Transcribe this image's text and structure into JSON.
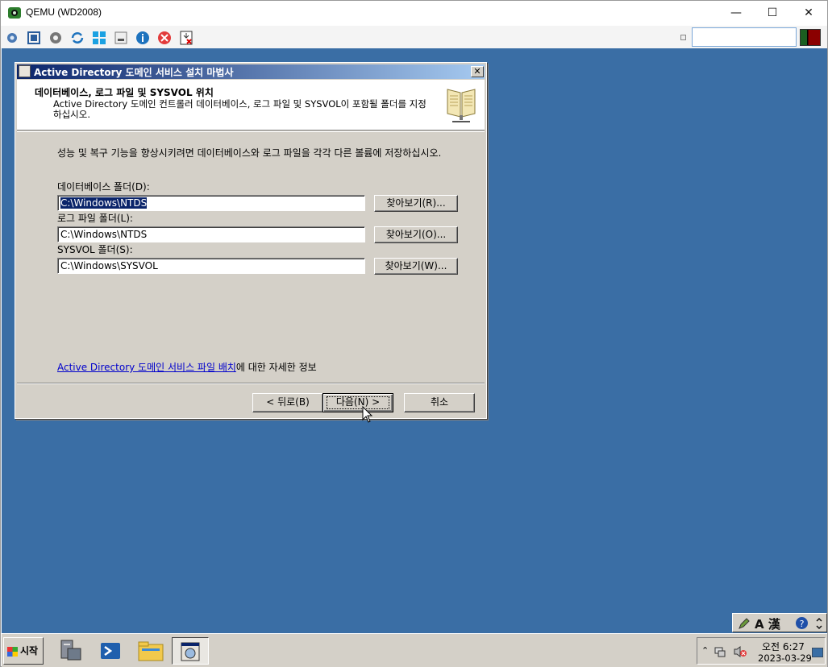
{
  "host": {
    "title": "QEMU (WD2008)",
    "minimize": "—",
    "maximize": "☐",
    "close": "✕"
  },
  "toolbar": {
    "icons": [
      "cluster-icon",
      "fullscreen-icon",
      "settings-icon",
      "refresh-icon",
      "windows-icon",
      "usb-icon",
      "info-icon",
      "stop-icon",
      "eject-icon"
    ],
    "search_value": ""
  },
  "wizard": {
    "title": "Active Directory 도메인 서비스 설치 마법사",
    "heading": "데이터베이스, 로그 파일 및 SYSVOL 위치",
    "subtext": "Active Directory 도메인 컨트롤러 데이터베이스, 로그 파일 및 SYSVOL이 포함될 폴더를 지정하십시오.",
    "intro": "성능 및 복구 기능을 향상시키려면 데이터베이스와 로그 파일을 각각 다른 볼륨에 저장하십시오.",
    "fields": [
      {
        "label": "데이터베이스 폴더(D):",
        "value": "C:\\Windows\\NTDS",
        "browse": "찾아보기(R)..."
      },
      {
        "label": "로그 파일 폴더(L):",
        "value": "C:\\Windows\\NTDS",
        "browse": "찾아보기(O)..."
      },
      {
        "label": "SYSVOL 폴더(S):",
        "value": "C:\\Windows\\SYSVOL",
        "browse": "찾아보기(W)..."
      }
    ],
    "link_text": "Active Directory 도메인 서비스 파일 배치",
    "link_suffix": "에 대한 자세한 정보",
    "buttons": {
      "back": "< 뒤로(B)",
      "next": "다음(N) >",
      "cancel": "취소"
    }
  },
  "taskbar": {
    "start_label": "시작",
    "apps": [
      "server-manager-icon",
      "powershell-icon",
      "explorer-folder-icon",
      "wizard-app-icon"
    ],
    "clock_time": "오전 6:27",
    "clock_date": "2023-03-29",
    "lang_text": "A 漢"
  },
  "colors": {
    "desktop": "#3a6ea5",
    "titlebar_start": "#0a246a",
    "titlebar_end": "#a6caf0",
    "link": "#0000cc"
  }
}
